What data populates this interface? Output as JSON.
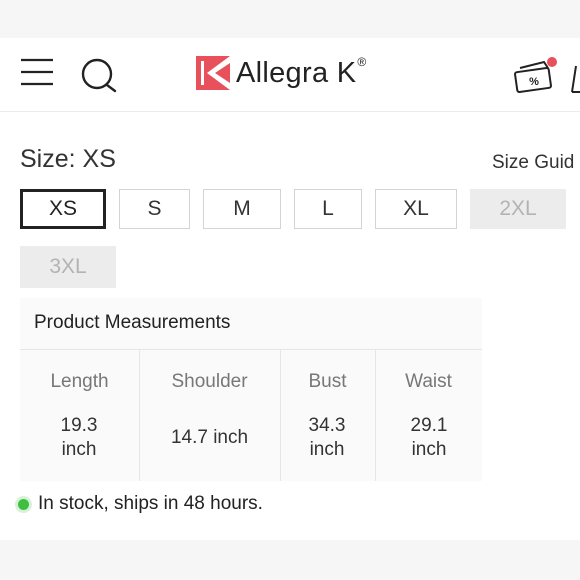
{
  "header": {
    "brand_name": "Allegra K",
    "brand_mark": "®",
    "icons": [
      "menu-icon",
      "search-icon",
      "coupon-icon",
      "cart-icon"
    ],
    "coupon_symbol": "%",
    "accent_color": "#e8505b"
  },
  "size": {
    "label": "Size: XS",
    "guide_label": "Size Guid",
    "options": [
      {
        "label": "XS",
        "state": "selected"
      },
      {
        "label": "S",
        "state": "available"
      },
      {
        "label": "M",
        "state": "available"
      },
      {
        "label": "L",
        "state": "available"
      },
      {
        "label": "XL",
        "state": "available"
      },
      {
        "label": "2XL",
        "state": "unavailable"
      },
      {
        "label": "3XL",
        "state": "unavailable"
      }
    ]
  },
  "measurements": {
    "title": "Product Measurements",
    "columns": [
      {
        "label": "Length",
        "value": "19.3 inch"
      },
      {
        "label": "Shoulder",
        "value": "14.7 inch"
      },
      {
        "label": "Bust",
        "value": "34.3 inch"
      },
      {
        "label": "Waist",
        "value": "29.1 inch"
      }
    ]
  },
  "stock": {
    "text": "In stock, ships in 48 hours.",
    "status_color": "#3fbf3f"
  }
}
